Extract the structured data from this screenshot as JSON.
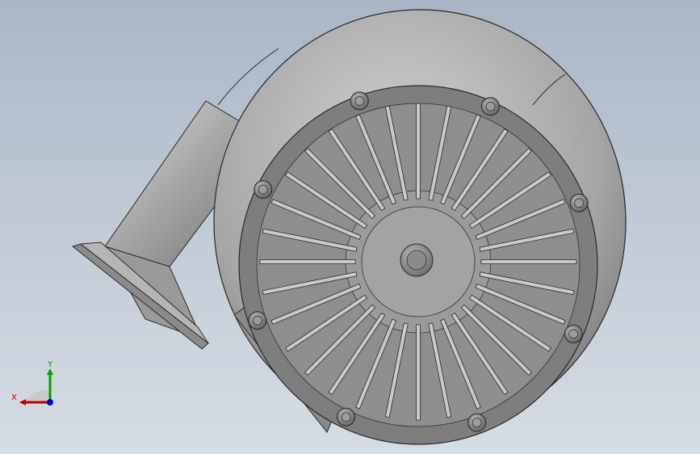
{
  "viewport": {
    "background_top": "#aab6c6",
    "background_bottom": "#d6dce3"
  },
  "model": {
    "part": "centrifugal-blower",
    "body_color": "#8c8c8c",
    "edge_color": "#2a2a2a",
    "vane_count": 32,
    "bolt_count": 8
  },
  "triad": {
    "x_label": "X",
    "y_label": "Y",
    "x_color": "#c00000",
    "y_color": "#00a000",
    "z_color": "#0000d0"
  }
}
